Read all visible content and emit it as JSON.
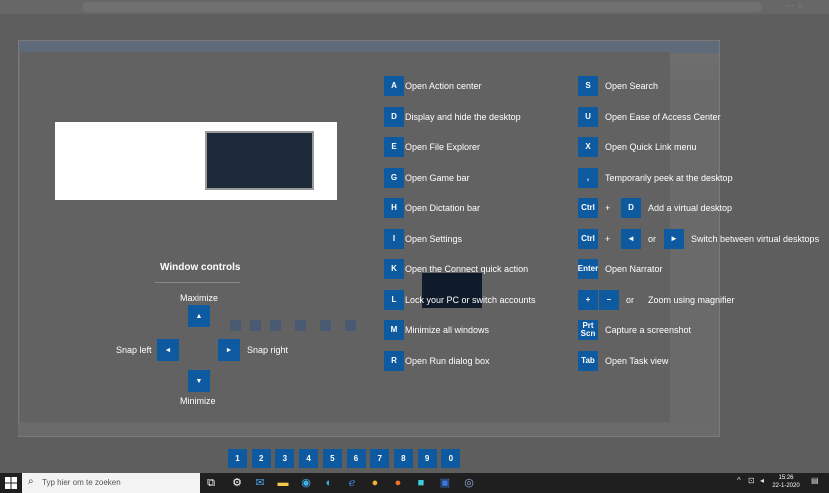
{
  "left_column": [
    {
      "key": "A",
      "label": "Open Action center"
    },
    {
      "key": "D",
      "label": "Display and hide the desktop"
    },
    {
      "key": "E",
      "label": "Open File Explorer"
    },
    {
      "key": "G",
      "label": "Open Game bar"
    },
    {
      "key": "H",
      "label": "Open Dictation bar"
    },
    {
      "key": "I",
      "label": "Open Settings"
    },
    {
      "key": "K",
      "label": "Open the Connect quick action"
    },
    {
      "key": "L",
      "label": "Lock your PC or switch accounts"
    },
    {
      "key": "M",
      "label": "Minimize all windows"
    },
    {
      "key": "R",
      "label": "Open Run dialog box"
    }
  ],
  "right_column": [
    {
      "key": "S",
      "label": "Open Search"
    },
    {
      "key": "U",
      "label": "Open Ease of Access Center"
    },
    {
      "key": "X",
      "label": "Open Quick Link menu"
    },
    {
      "key": ",",
      "label": "Temporarily peek at the desktop"
    },
    {
      "key": "Ctrl",
      "plus": "+",
      "key2": "D",
      "label": "Add a virtual desktop"
    },
    {
      "key": "Ctrl",
      "plus": "+",
      "key2": "◄",
      "or": "or",
      "key3": "►",
      "label": "Switch between virtual desktops"
    },
    {
      "key": "Enter",
      "label": "Open Narrator"
    },
    {
      "key": "+",
      "or": "or",
      "key2": "–",
      "label": "Zoom using magnifier"
    },
    {
      "key": "Prt Scn",
      "label": "Capture a screenshot"
    },
    {
      "key": "Tab",
      "label": "Open Task view"
    }
  ],
  "window_controls": {
    "title": "Window controls",
    "maximize": "Maximize",
    "minimize": "Minimize",
    "snap_left": "Snap left",
    "snap_right": "Snap right",
    "up": "▲",
    "down": "▼",
    "left": "◄",
    "right": "►"
  },
  "number_keys": [
    "1",
    "2",
    "3",
    "4",
    "5",
    "6",
    "7",
    "8",
    "9",
    "0"
  ],
  "taskbar": {
    "search_placeholder": "Typ hier om te zoeken",
    "search_icon": "search-icon",
    "time": "15:26",
    "date": "22-1-2020"
  },
  "colors": {
    "key_blue": "#0d5aa0"
  }
}
